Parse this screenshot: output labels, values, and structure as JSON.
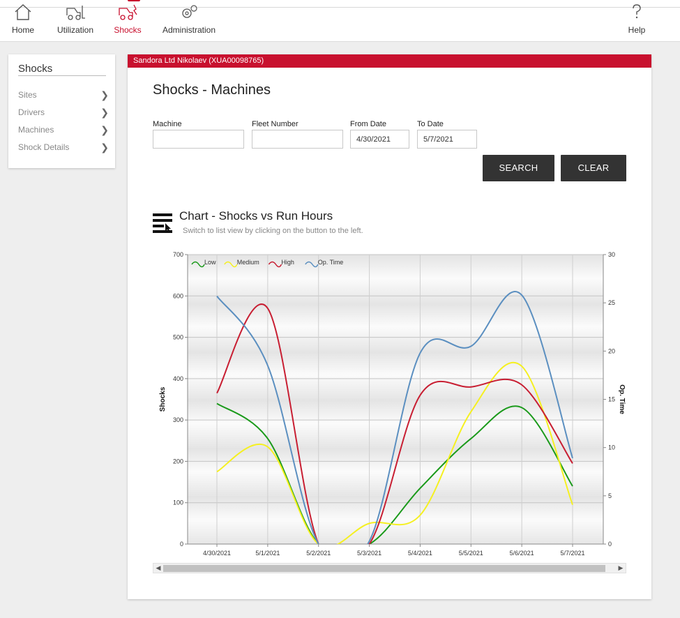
{
  "nav": {
    "items": [
      {
        "label": "Home",
        "icon": "house-icon"
      },
      {
        "label": "Utilization",
        "icon": "forklift-icon"
      },
      {
        "label": "Shocks",
        "icon": "forklift-shock-icon"
      },
      {
        "label": "Administration",
        "icon": "gears-icon"
      }
    ],
    "help": {
      "label": "Help",
      "icon": "question-icon"
    },
    "active_color": "#c8102e"
  },
  "sidebar": {
    "title": "Shocks",
    "items": [
      {
        "label": "Sites"
      },
      {
        "label": "Drivers"
      },
      {
        "label": "Machines"
      },
      {
        "label": "Shock Details"
      }
    ]
  },
  "main": {
    "banner": "Sandora Ltd Nikolaev (XUA00098765)",
    "title": "Shocks - Machines",
    "filters": {
      "machine_label": "Machine",
      "machine_value": "",
      "fleet_label": "Fleet Number",
      "fleet_value": "",
      "from_label": "From Date",
      "from_value": "4/30/2021",
      "to_label": "To Date",
      "to_value": "5/7/2021"
    },
    "search_label": "SEARCH",
    "clear_label": "CLEAR",
    "chart_title": "Chart - Shocks vs Run Hours",
    "chart_subtitle": "Switch to list view by clicking on the button to the left."
  },
  "chart_data": {
    "type": "line",
    "categories": [
      "4/30/2021",
      "5/1/2021",
      "5/2/2021",
      "5/3/2021",
      "5/4/2021",
      "5/5/2021",
      "5/6/2021",
      "5/7/2021"
    ],
    "ylabel": "Shocks",
    "y2label": "Op. Time",
    "ylim": [
      0,
      700
    ],
    "yticks": [
      "0",
      "100",
      "200",
      "300",
      "400",
      "500",
      "600",
      "700"
    ],
    "y2lim": [
      0,
      30
    ],
    "y2ticks": [
      "0",
      "5",
      "10",
      "15",
      "20",
      "25",
      "30"
    ],
    "legend_placement": "top-left",
    "grid": true,
    "series": [
      {
        "name": "Low",
        "color": "#1a9a1a",
        "axis": "left",
        "values": [
          340,
          255,
          0,
          0,
          135,
          255,
          330,
          140
        ]
      },
      {
        "name": "Medium",
        "color": "#f5f020",
        "axis": "left",
        "values": [
          175,
          235,
          0,
          50,
          70,
          320,
          430,
          95
        ]
      },
      {
        "name": "High",
        "color": "#c81e32",
        "axis": "left",
        "values": [
          365,
          570,
          0,
          0,
          360,
          380,
          385,
          195
        ]
      },
      {
        "name": "Op. Time",
        "color": "#5b8fc0",
        "axis": "right",
        "values": [
          25.7,
          18.5,
          0,
          0.3,
          19.8,
          20.5,
          25.8,
          8.9
        ]
      }
    ]
  }
}
